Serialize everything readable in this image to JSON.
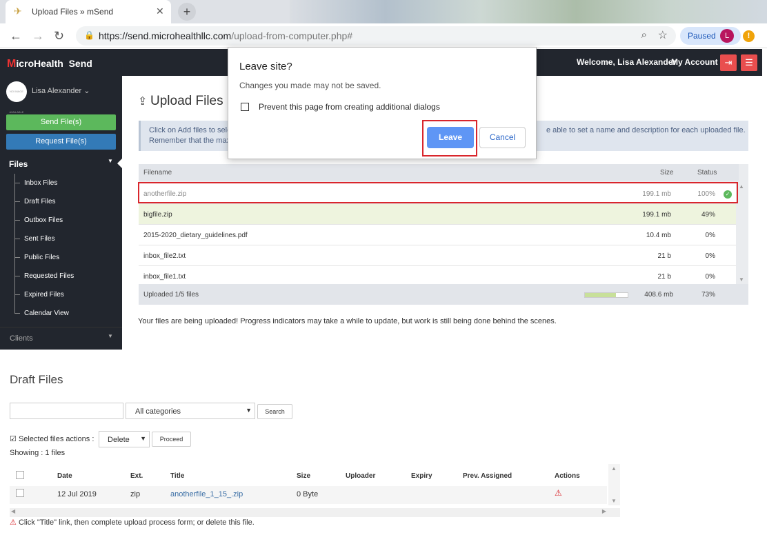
{
  "browser": {
    "tab_title": "Upload Files » mSend",
    "url_host": "https://send.microhealthllc.com",
    "url_path": "/upload-from-computer.php#",
    "profile_status": "Paused",
    "profile_initial": "L",
    "alert_glyph": "!"
  },
  "header": {
    "brand_first": "M",
    "brand_rest": "icroHealth  Send",
    "welcome": "Welcome, Lisa Alexander",
    "my_account": "My Account"
  },
  "sidebar": {
    "avatar_text": "NO IMAGE AVAILABLE",
    "user_name": "Lisa Alexander",
    "send_button": "Send File(s)",
    "request_button": "Request File(s)",
    "files_section": "Files",
    "items": [
      {
        "label": "Inbox Files"
      },
      {
        "label": "Draft Files"
      },
      {
        "label": "Outbox Files"
      },
      {
        "label": "Sent Files"
      },
      {
        "label": "Public Files"
      },
      {
        "label": "Requested Files"
      },
      {
        "label": "Expired Files"
      },
      {
        "label": "Calendar View"
      }
    ],
    "clients_section": "Clients"
  },
  "upload": {
    "title": "Upload Files",
    "info_line1_start": "Click on Add files to sele",
    "info_line1_end": "e able to set a name and description for each uploaded file.",
    "info_line2": "Remember that the max",
    "columns": {
      "filename": "Filename",
      "size": "Size",
      "status": "Status"
    },
    "rows": [
      {
        "filename": "anotherfile.zip",
        "size": "199.1 mb",
        "status": "100%"
      },
      {
        "filename": "bigfile.zip",
        "size": "199.1 mb",
        "status": "49%"
      },
      {
        "filename": "2015-2020_dietary_guidelines.pdf",
        "size": "10.4 mb",
        "status": "0%"
      },
      {
        "filename": "inbox_file2.txt",
        "size": "21 b",
        "status": "0%"
      },
      {
        "filename": "inbox_file1.txt",
        "size": "21 b",
        "status": "0%"
      }
    ],
    "footer": {
      "label": "Uploaded 1/5 files",
      "total_size": "408.6 mb",
      "total_status": "73%",
      "progress": 0.73
    },
    "note": "Your files are being uploaded! Progress indicators may take a while to update, but work is still being done behind the scenes."
  },
  "draft": {
    "title": "Draft Files",
    "search_placeholder": "",
    "category_selected": "All categories",
    "search_button": "Search",
    "selected_actions_label": "Selected files actions :",
    "action_selected": "Delete",
    "proceed_button": "Proceed",
    "showing": "Showing : 1 files",
    "columns": {
      "date": "Date",
      "ext": "Ext.",
      "title": "Title",
      "size": "Size",
      "uploader": "Uploader",
      "expiry": "Expiry",
      "prev_assigned": "Prev. Assigned",
      "actions": "Actions"
    },
    "row": {
      "date": "12 Jul 2019",
      "ext": "zip",
      "title": "anotherfile_1_15_.zip",
      "size": "0 Byte"
    },
    "footnote": "Click \"Title\" link, then complete upload process form; or delete this file."
  },
  "dialog": {
    "title": "Leave site?",
    "message": "Changes you made may not be saved.",
    "checkbox_label": "Prevent this page from creating additional dialogs",
    "leave_button": "Leave",
    "cancel_button": "Cancel"
  },
  "colors": {
    "header_bg": "#22262e",
    "send_green": "#5cb85c",
    "request_blue": "#337ab7",
    "highlight_red": "#d9262c",
    "leave_blue": "#5f96f5"
  }
}
